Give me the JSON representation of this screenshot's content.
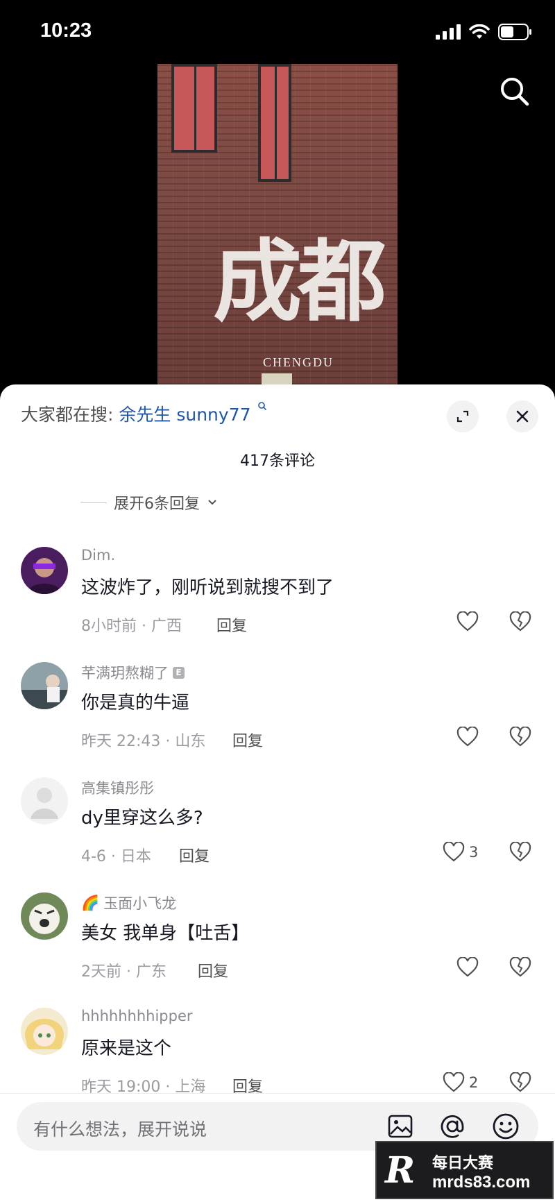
{
  "status_bar": {
    "time": "10:23"
  },
  "video": {
    "wall_text": "成都",
    "wall_subtext": "CHENGDU"
  },
  "panel": {
    "trending_label": "大家都在搜:",
    "trending_keyword": "余先生 sunny77",
    "comment_count": "417条评论",
    "expand_replies": "展开6条回复"
  },
  "comments": [
    {
      "username": "Dim.",
      "text": "这波炸了，刚听说到就搜不到了",
      "meta": "8小时前 · 广西",
      "reply": "回复",
      "likes": ""
    },
    {
      "username": "芊满玥熬糊了",
      "badge": "E",
      "text": "你是真的牛逼",
      "meta": "昨天 22:43 · 山东",
      "reply": "回复",
      "likes": ""
    },
    {
      "username": "高集镇彤彤",
      "text": "dy里穿这么多?",
      "meta": "4-6 · 日本",
      "reply": "回复",
      "likes": "3"
    },
    {
      "username": "玉面小飞龙",
      "prefix_emoji": "🌈",
      "text": "美女 我单身【吐舌】",
      "meta": "2天前 · 广东",
      "reply": "回复",
      "likes": ""
    },
    {
      "username": "hhhhhhhhipper",
      "text": "原来是这个",
      "meta": "昨天 19:00 · 上海",
      "reply": "回复",
      "likes": "2"
    }
  ],
  "input": {
    "placeholder": "有什么想法，展开说说"
  },
  "watermark": {
    "logo": "R",
    "line1": "每日大赛",
    "line2": "mrds83.com"
  }
}
